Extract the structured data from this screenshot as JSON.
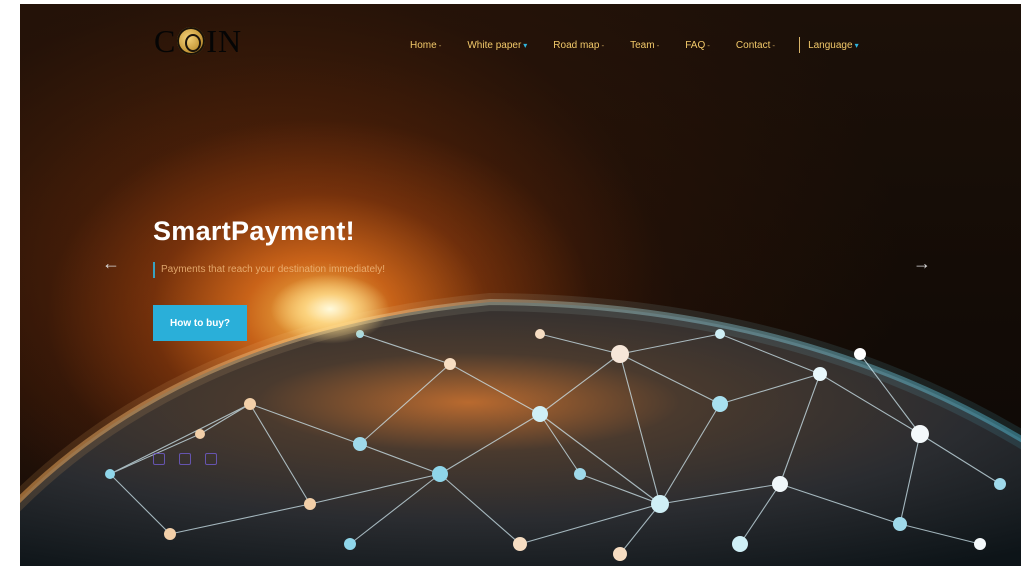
{
  "logo": {
    "text_left": "C",
    "text_right": "IN",
    "icon": "coin-icon"
  },
  "nav": {
    "items": [
      {
        "label": "Home",
        "caret": "-"
      },
      {
        "label": "White paper",
        "caret": "▾"
      },
      {
        "label": "Road map",
        "caret": "-"
      },
      {
        "label": "Team",
        "caret": "-"
      },
      {
        "label": "FAQ",
        "caret": "-"
      },
      {
        "label": "Contact",
        "caret": "-"
      }
    ],
    "language": {
      "label": "Language",
      "caret": "▾"
    }
  },
  "hero": {
    "title": "SmartPayment!",
    "subtitle": "Payments that reach your destination immediately!",
    "cta_label": "How to buy?",
    "prev_arrow": "←",
    "next_arrow": "→"
  },
  "colors": {
    "accent": "#2aafd9",
    "nav_text": "#f2c96a",
    "headline": "#ffffff"
  },
  "icons": {
    "prev": "arrow-left-icon",
    "next": "arrow-right-icon",
    "social": [
      "twitter-icon",
      "facebook-icon",
      "telegram-icon"
    ]
  }
}
